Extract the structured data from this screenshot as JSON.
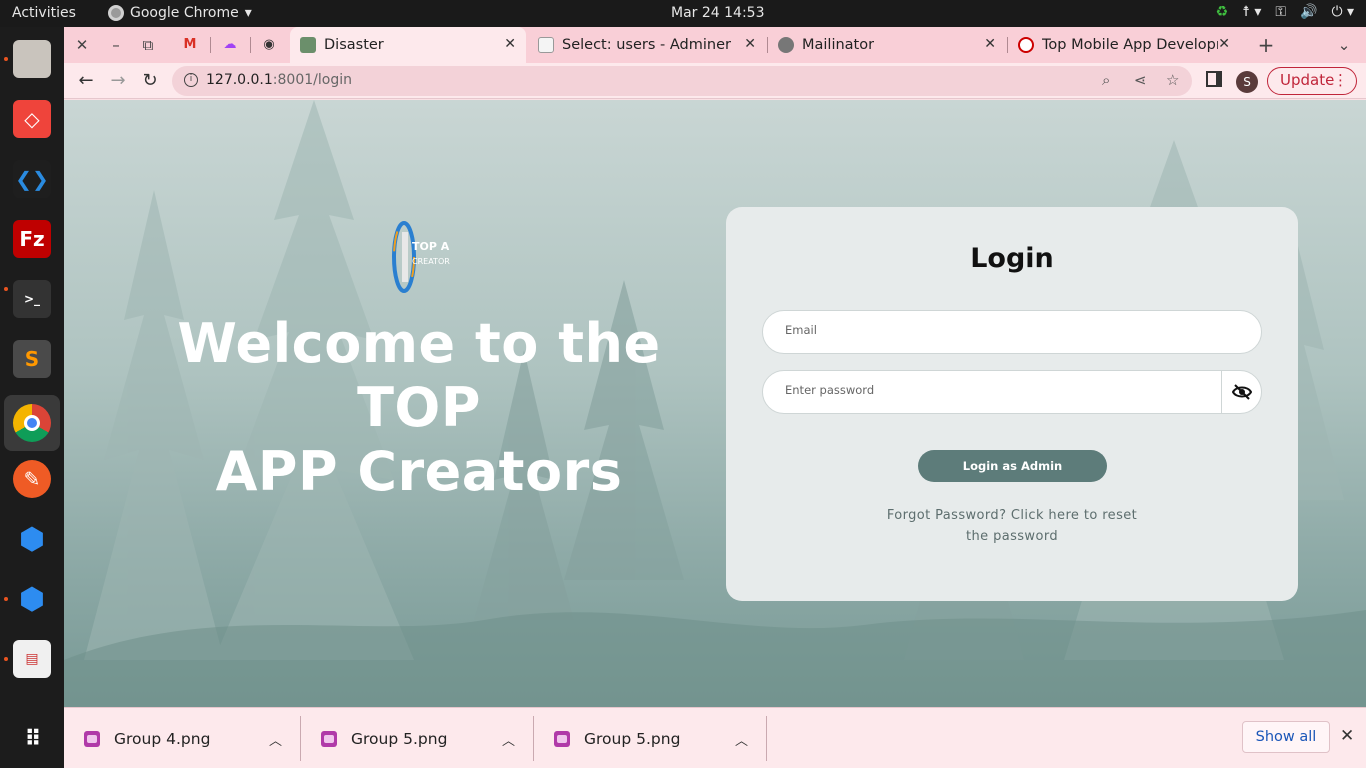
{
  "system_bar": {
    "activities": "Activities",
    "app_name": "Google Chrome",
    "clock": "Mar 24  14:53"
  },
  "dock": {
    "items": [
      "files",
      "anydesk",
      "vscode",
      "filezilla",
      "terminal",
      "sublime-text",
      "chrome",
      "postman",
      "app-launcher-a",
      "app-launcher-b",
      "text-editor",
      "show-apps"
    ]
  },
  "browser": {
    "tabs": [
      {
        "title": "Disaster",
        "active": true
      },
      {
        "title": "Select: users - Adminer",
        "active": false
      },
      {
        "title": "Mailinator",
        "active": false
      },
      {
        "title": "Top Mobile App Developm",
        "active": false
      }
    ],
    "url_host": "127.0.0.1",
    "url_rest": ":8001/login",
    "profile_initial": "S",
    "update_label": "Update"
  },
  "page": {
    "welcome_line1": "Welcome to the TOP",
    "welcome_line2": "APP Creators",
    "login": {
      "title": "Login",
      "email_placeholder": "Email",
      "password_placeholder": "Enter password",
      "submit_label": "Login as Admin",
      "forgot_line1": "Forgot Password? Click here to reset",
      "forgot_line2": "the password"
    }
  },
  "downloads": {
    "items": [
      "Group 4.png",
      "Group 5.png",
      "Group 5.png"
    ],
    "show_all": "Show all"
  },
  "colors": {
    "tab_strip": "#f9cfd7",
    "toolbar": "#fde9ec",
    "login_button": "#5d7c7a",
    "update_accent": "#c0253a",
    "show_all_link": "#1a56b8"
  }
}
